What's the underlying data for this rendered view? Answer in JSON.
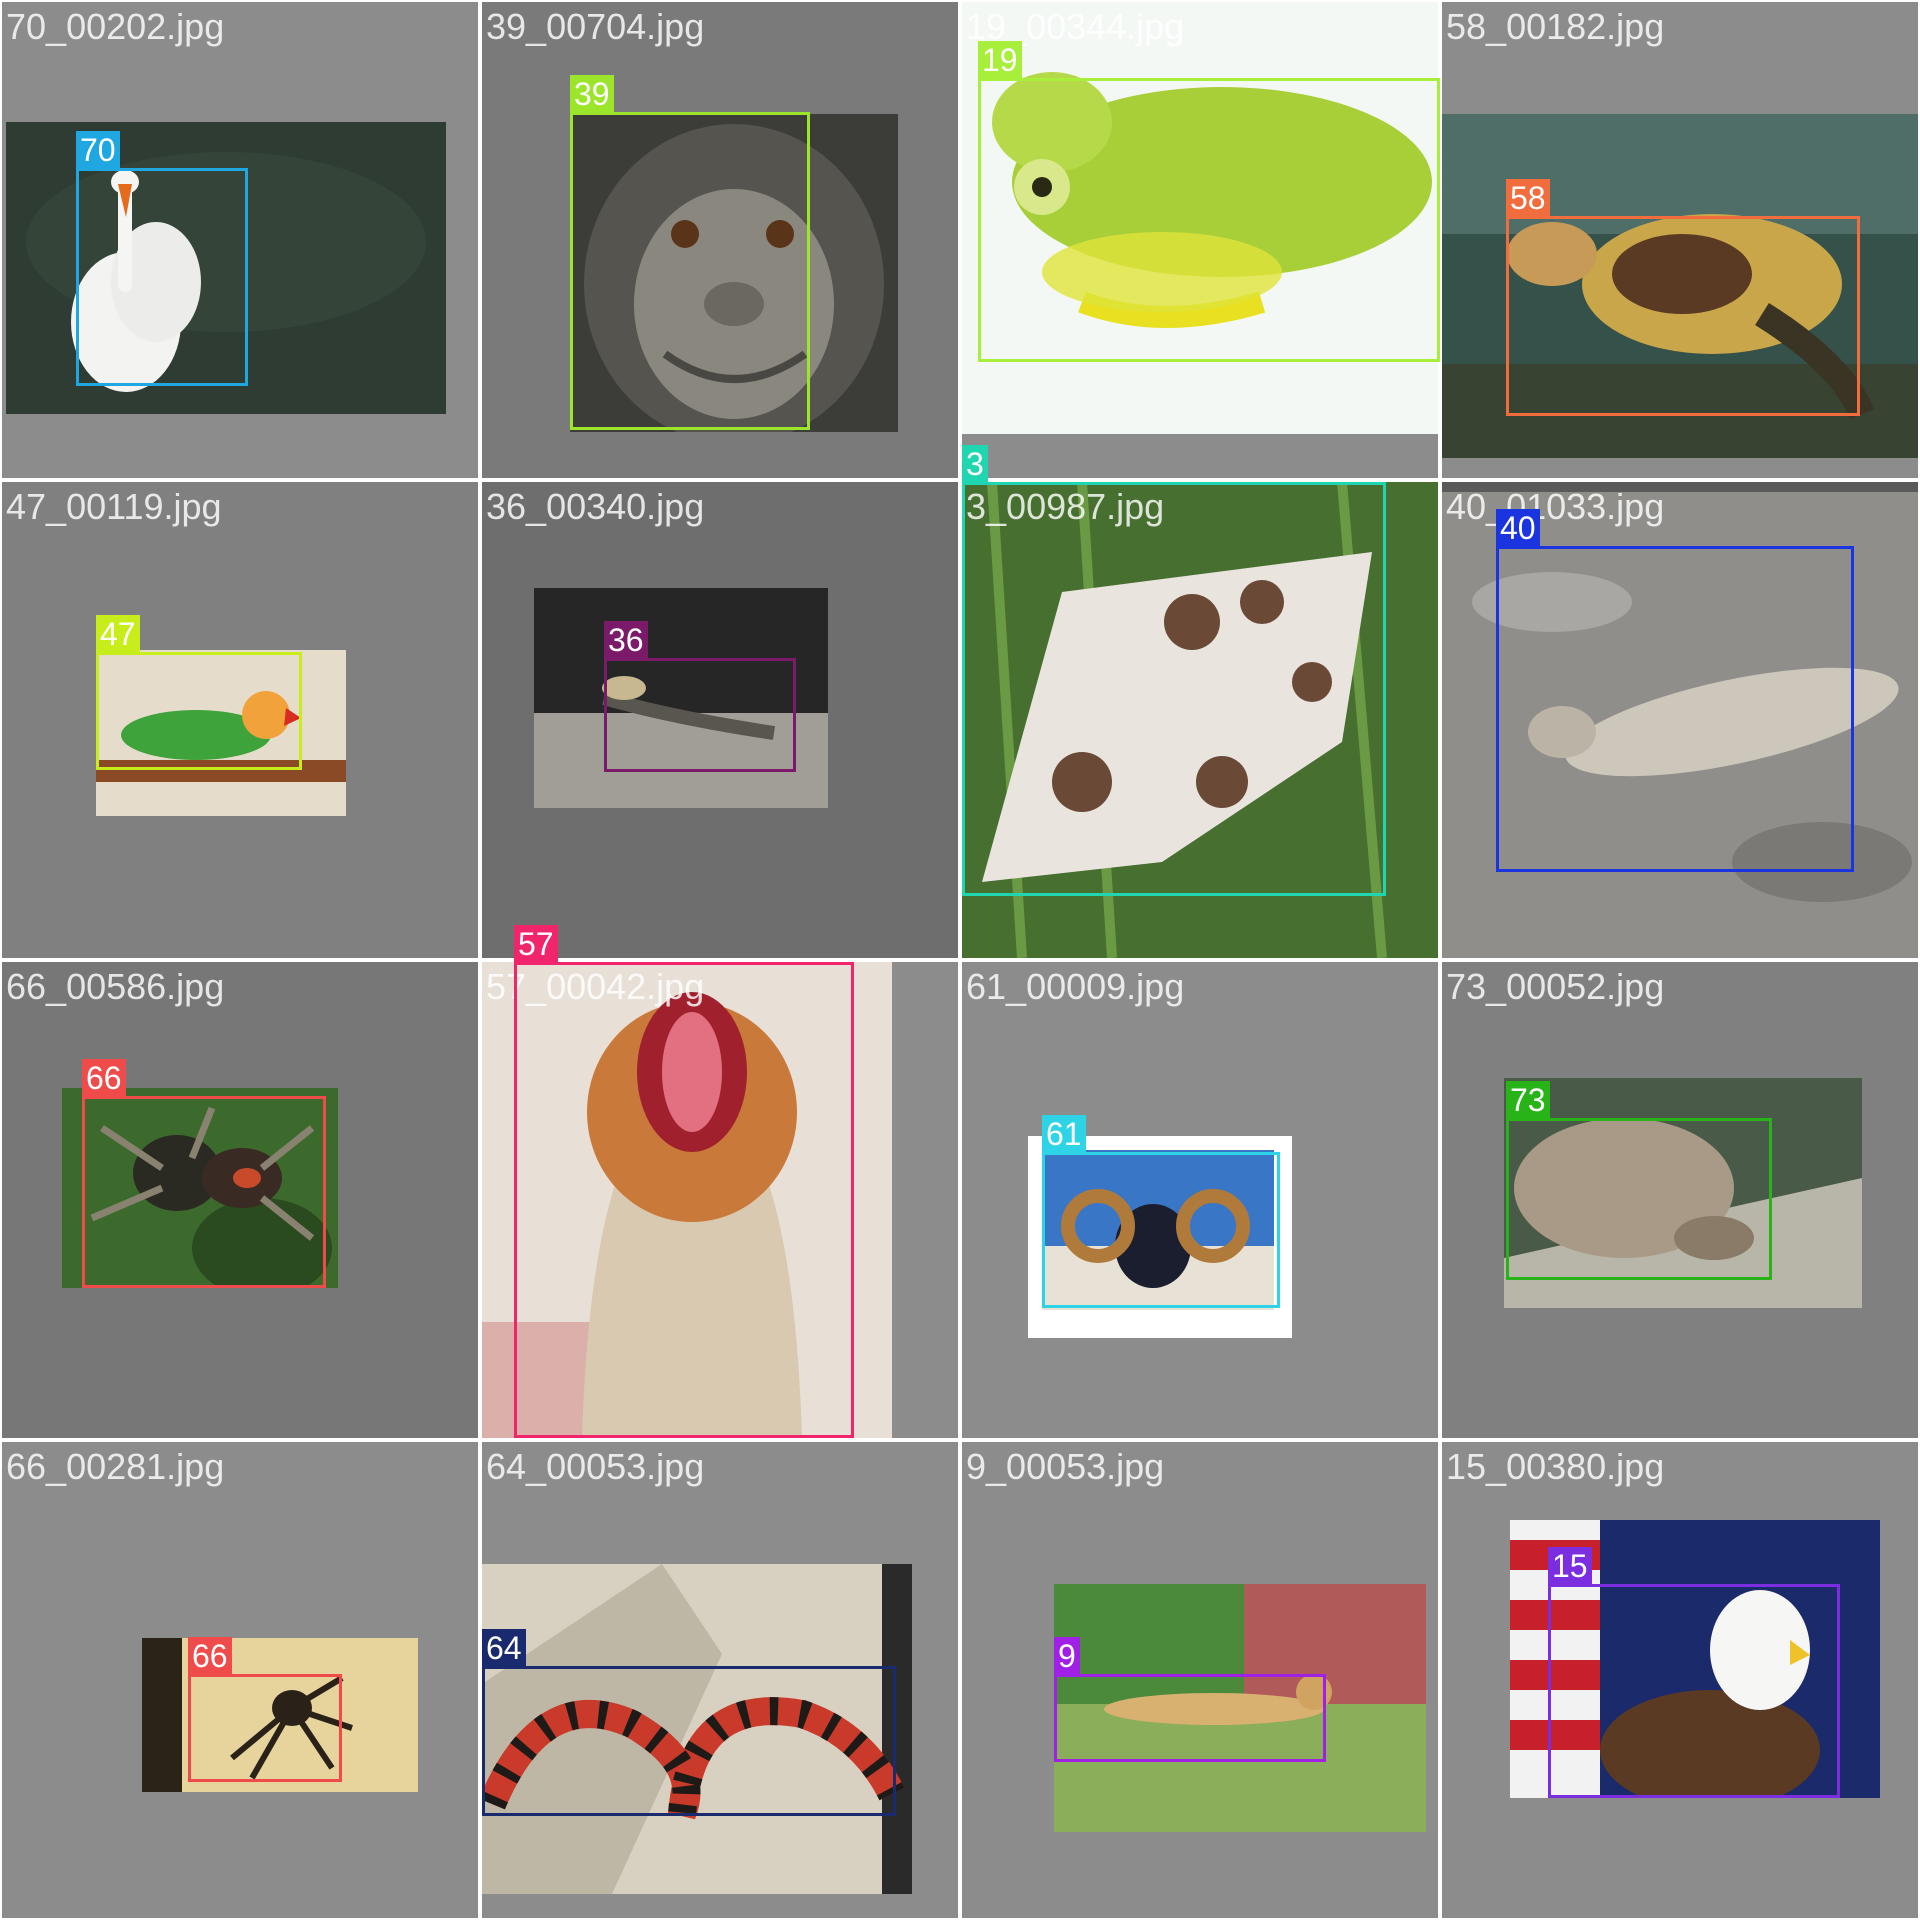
{
  "mosaic": {
    "tiles": [
      {
        "filename": "70_00202.jpg",
        "label": "70",
        "color": "#1ea7e1",
        "bg": "#8c8c8c",
        "subject": "swan",
        "photo_colors": [
          "#2a3a33",
          "#f2f2f2"
        ]
      },
      {
        "filename": "39_00704.jpg",
        "label": "39",
        "color": "#9be52b",
        "bg": "#7a7a7a",
        "subject": "chimpanzee",
        "photo_colors": [
          "#4a4a46",
          "#8a8a80"
        ]
      },
      {
        "filename": "19_00344.jpg",
        "label": "19",
        "color": "#a7ef3a",
        "bg": "#8c8c8c",
        "subject": "glass frog",
        "photo_colors": [
          "#f4f9f6",
          "#a8d038"
        ]
      },
      {
        "filename": "58_00182.jpg",
        "label": "58",
        "color": "#f26d3d",
        "bg": "#8c8c8c",
        "subject": "sea turtle",
        "photo_colors": [
          "#3c5a4e",
          "#c9a64a"
        ]
      },
      {
        "filename": "47_00119.jpg",
        "label": "47",
        "color": "#c7ee1a",
        "bg": "#808080",
        "subject": "lovebird",
        "photo_colors": [
          "#e8dccb",
          "#3da33a"
        ]
      },
      {
        "filename": "36_00340.jpg",
        "label": "36",
        "color": "#7c1a6a",
        "bg": "#6e6e6e",
        "subject": "lizard",
        "photo_colors": [
          "#2a2a2a",
          "#9a9890"
        ]
      },
      {
        "filename": "3_00987.jpg",
        "label": "3",
        "color": "#20d6b0",
        "bg": "#4f7a3a",
        "subject": "butterfly",
        "photo_colors": [
          "#3f6a2c",
          "#e9e4de"
        ]
      },
      {
        "filename": "40_01033.jpg",
        "label": "40",
        "color": "#1a35e0",
        "bg": "#8a8a88",
        "subject": "moth",
        "photo_colors": [
          "#8f8e8b",
          "#cdc7bb"
        ]
      },
      {
        "filename": "66_00586.jpg",
        "label": "66",
        "color": "#f04b4b",
        "bg": "#777777",
        "subject": "jumping spider",
        "photo_colors": [
          "#3f6b2e",
          "#2a2a22"
        ]
      },
      {
        "filename": "57_00042.jpg",
        "label": "57",
        "color": "#f0256c",
        "bg": "#8c8c8c",
        "subject": "sea lion",
        "photo_colors": [
          "#e8ddd0",
          "#c97a3a"
        ]
      },
      {
        "filename": "61_00009.jpg",
        "label": "61",
        "color": "#2ed4e6",
        "bg": "#8c8c8c",
        "subject": "ram",
        "photo_colors": [
          "#3c78c8",
          "#e8e2d6"
        ]
      },
      {
        "filename": "73_00052.jpg",
        "label": "73",
        "color": "#28b418",
        "bg": "#808080",
        "subject": "tortoise",
        "photo_colors": [
          "#4a5a48",
          "#a89a86"
        ]
      },
      {
        "filename": "66_00281.jpg",
        "label": "66",
        "color": "#f04b4b",
        "bg": "#8c8c8c",
        "subject": "spider",
        "photo_colors": [
          "#e8d8a0",
          "#2a2218"
        ]
      },
      {
        "filename": "64_00053.jpg",
        "label": "64",
        "color": "#1a2a6e",
        "bg": "#8c8c8c",
        "subject": "milk snake",
        "photo_colors": [
          "#d8d0c0",
          "#c93a2a"
        ]
      },
      {
        "filename": "9_00053.jpg",
        "label": "9",
        "color": "#a020e6",
        "bg": "#8c8c8c",
        "subject": "cheetah",
        "photo_colors": [
          "#4a8a3a",
          "#d8b070"
        ]
      },
      {
        "filename": "15_00380.jpg",
        "label": "15",
        "color": "#7a2ee0",
        "bg": "#8c8c8c",
        "subject": "bald eagle",
        "photo_colors": [
          "#1a2a6a",
          "#5a3a22"
        ]
      }
    ]
  }
}
